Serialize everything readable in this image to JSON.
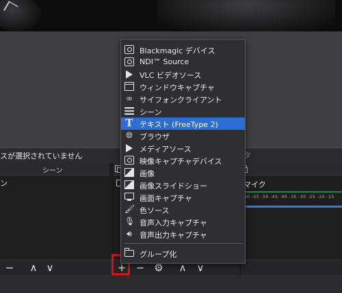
{
  "status_bar": {
    "text": "スが選択されていません",
    "right_tab": "タ"
  },
  "panels": {
    "scenes": {
      "title": "シーン",
      "items": [
        "ン"
      ]
    },
    "mixer": {
      "channel": "マイク",
      "scale": "-60  -55  -50  -45  -40  -35  -30  -25  -20  -15"
    }
  },
  "menu": {
    "items": [
      {
        "label": "Blackmagic デバイス",
        "icon": "camera-icon"
      },
      {
        "label": "NDI™ Source",
        "icon": "camera-icon"
      },
      {
        "label": "VLC ビデオソース",
        "icon": "play-icon"
      },
      {
        "label": "ウィンドウキャプチャ",
        "icon": "window-icon"
      },
      {
        "label": "サイフォンクライアント",
        "icon": "link-icon"
      },
      {
        "label": "シーン",
        "icon": "list-icon"
      },
      {
        "label": "テキスト (FreeType 2)",
        "icon": "text-icon",
        "selected": true
      },
      {
        "label": "ブラウザ",
        "icon": "globe-icon"
      },
      {
        "label": "メディアソース",
        "icon": "play-icon"
      },
      {
        "label": "映像キャプチャデバイス",
        "icon": "camera-icon"
      },
      {
        "label": "画像",
        "icon": "image-icon"
      },
      {
        "label": "画像スライドショー",
        "icon": "slideshow-icon"
      },
      {
        "label": "画面キャプチャ",
        "icon": "monitor-icon"
      },
      {
        "label": "色ソース",
        "icon": "brush-icon"
      },
      {
        "label": "音声入力キャプチャ",
        "icon": "microphone-icon"
      },
      {
        "label": "音声出力キャプチャ",
        "icon": "speaker-icon"
      }
    ],
    "group": {
      "label": "グループ化",
      "icon": "group-icon"
    }
  },
  "toolbars": {
    "scenes": [
      "−",
      "∧",
      "∨"
    ],
    "sources": [
      "+",
      "−",
      "⚙",
      "∧",
      "∨"
    ]
  },
  "colors": {
    "highlight": "#2b6fd6",
    "annotation_box": "#e01010",
    "meter_blue": "#2a7fe0"
  }
}
